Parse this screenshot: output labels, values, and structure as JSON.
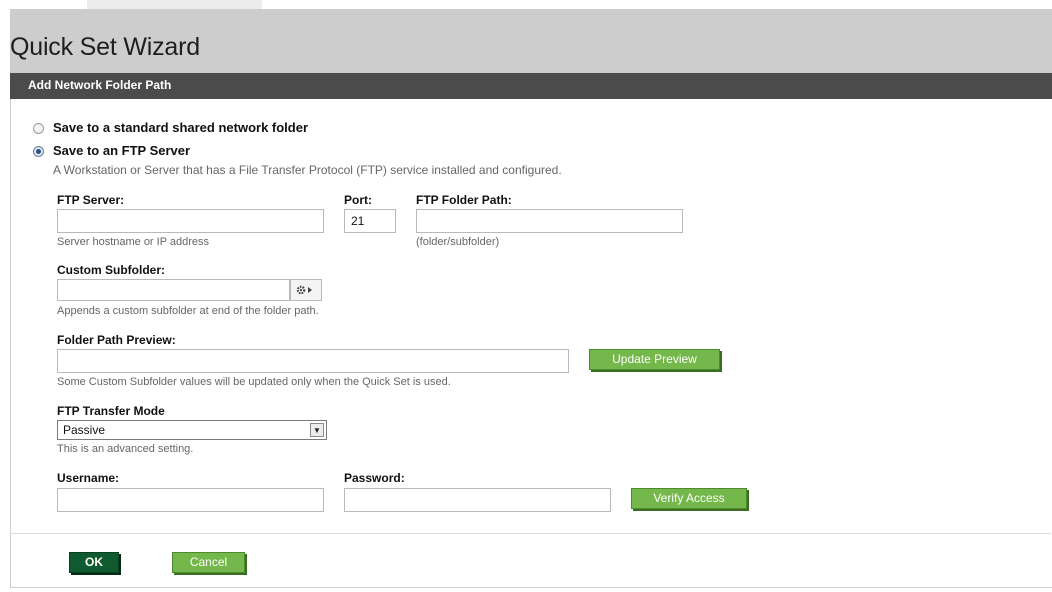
{
  "window": {
    "title": "Quick Set Wizard"
  },
  "section": {
    "title": "Add Network Folder Path"
  },
  "options": {
    "shared_folder_label": "Save to a standard shared network folder",
    "ftp_label": "Save to an FTP Server",
    "ftp_description": "A Workstation or Server that has a File Transfer Protocol (FTP) service installed and configured.",
    "selected": "ftp"
  },
  "ftp_server": {
    "label": "FTP Server:",
    "value": "",
    "hint": "Server hostname or IP address"
  },
  "port": {
    "label": "Port:",
    "value": "21"
  },
  "ftp_folder_path": {
    "label": "FTP Folder Path:",
    "value": "",
    "hint": "(folder/subfolder)"
  },
  "custom_subfolder": {
    "label": "Custom Subfolder:",
    "value": "",
    "hint": "Appends a custom subfolder at end of the folder path."
  },
  "folder_path_preview": {
    "label": "Folder Path Preview:",
    "value": "",
    "hint": "Some Custom Subfolder values will be updated only when the Quick Set is used.",
    "update_button": "Update Preview"
  },
  "transfer_mode": {
    "label": "FTP Transfer Mode",
    "selected": "Passive",
    "hint": "This is an advanced setting."
  },
  "username": {
    "label": "Username:",
    "value": ""
  },
  "password": {
    "label": "Password:",
    "value": ""
  },
  "verify_button": "Verify Access",
  "footer": {
    "ok_label": "OK",
    "cancel_label": "Cancel"
  },
  "icons": {
    "gear": "gear-plus-icon",
    "dropdown": "chevron-down-icon"
  },
  "colors": {
    "header_bg": "#cdcdcd",
    "section_bar": "#4b4b4b",
    "green_button": "#74b74a",
    "ok_button": "#0f5a2e"
  }
}
